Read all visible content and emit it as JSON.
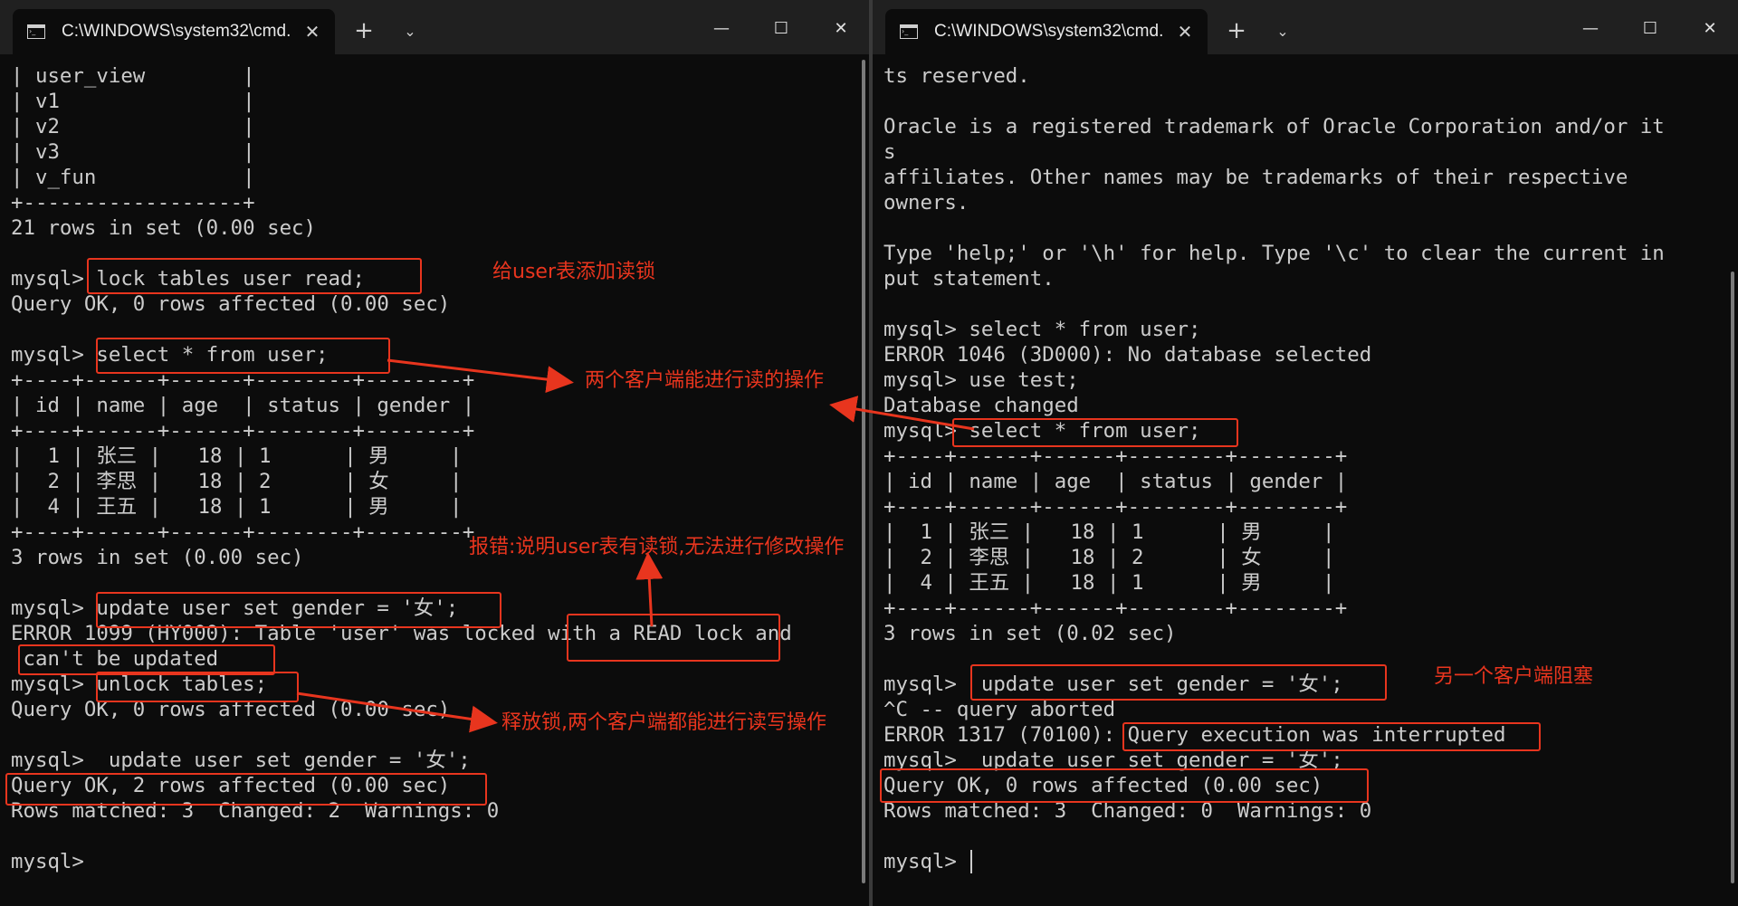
{
  "left_window": {
    "tab_title": "C:\\WINDOWS\\system32\\cmd.",
    "tab_close": "✕",
    "new_tab": "+",
    "dropdown": "⌄",
    "minimize": "—",
    "maximize": "☐",
    "close": "✕",
    "lines": [
      "| user_view        |",
      "| v1               |",
      "| v2               |",
      "| v3               |",
      "| v_fun            |",
      "+------------------+",
      "21 rows in set (0.00 sec)",
      "",
      "mysql> lock tables user read;",
      "Query OK, 0 rows affected (0.00 sec)",
      "",
      "mysql> select * from user;",
      "+----+------+------+--------+--------+",
      "| id | name | age  | status | gender |",
      "+----+------+------+--------+--------+",
      "|  1 | 张三 |   18 | 1      | 男     |",
      "|  2 | 李思 |   18 | 2      | 女     |",
      "|  4 | 王五 |   18 | 1      | 男     |",
      "+----+------+------+--------+--------+",
      "3 rows in set (0.00 sec)",
      "",
      "mysql> update user set gender = '女';",
      "ERROR 1099 (HY000): Table 'user' was locked with a READ lock and",
      " can't be updated",
      "mysql> unlock tables;",
      "Query OK, 0 rows affected (0.00 sec)",
      "",
      "mysql>  update user set gender = '女';",
      "Query OK, 2 rows affected (0.00 sec)",
      "Rows matched: 3  Changed: 2  Warnings: 0",
      "",
      "mysql>"
    ]
  },
  "right_window": {
    "tab_title": "C:\\WINDOWS\\system32\\cmd.",
    "tab_close": "✕",
    "new_tab": "+",
    "dropdown": "⌄",
    "minimize": "—",
    "maximize": "☐",
    "close": "✕",
    "lines": [
      "ts reserved.",
      "",
      "Oracle is a registered trademark of Oracle Corporation and/or it",
      "s",
      "affiliates. Other names may be trademarks of their respective",
      "owners.",
      "",
      "Type 'help;' or '\\h' for help. Type '\\c' to clear the current in",
      "put statement.",
      "",
      "mysql> select * from user;",
      "ERROR 1046 (3D000): No database selected",
      "mysql> use test;",
      "Database changed",
      "mysql> select * from user;",
      "+----+------+------+--------+--------+",
      "| id | name | age  | status | gender |",
      "+----+------+------+--------+--------+",
      "|  1 | 张三 |   18 | 1      | 男     |",
      "|  2 | 李思 |   18 | 2      | 女     |",
      "|  4 | 王五 |   18 | 1      | 男     |",
      "+----+------+------+--------+--------+",
      "3 rows in set (0.02 sec)",
      "",
      "mysql>  update user set gender = '女';",
      "^C -- query aborted",
      "ERROR 1317 (70100): Query execution was interrupted",
      "mysql>  update user set gender = '女';",
      "Query OK, 0 rows affected (0.00 sec)",
      "Rows matched: 3  Changed: 0  Warnings: 0",
      "",
      "mysql> "
    ]
  },
  "annotations": {
    "add_read_lock": "给user表添加读锁",
    "both_can_read": "两个客户端能进行读的操作",
    "error_explain": "报错:说明user表有读锁,无法进行修改操作",
    "release_lock": "释放锁,两个客户端都能进行读写操作",
    "other_blocked": "另一个客户端阻塞"
  },
  "colors": {
    "terminal_bg": "#0c0c0c",
    "terminal_text": "#cccccc",
    "titlebar_bg": "#202020",
    "annotation_red": "#e8351e"
  }
}
